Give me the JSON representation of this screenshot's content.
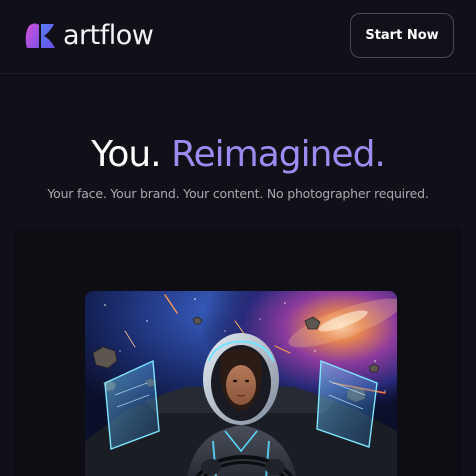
{
  "header": {
    "brand_name": "artflow",
    "logo_icon": "artflow-logo-icon",
    "cta_label": "Start Now"
  },
  "hero": {
    "title_part1": "You.",
    "title_part2": "Reimagined.",
    "subtitle": "Your face. Your brand. Your content. No photographer required."
  },
  "colors": {
    "background": "#111019",
    "accent": "#9c8cf2",
    "logo_purple": "#c74de0",
    "logo_blue": "#6a5cf0"
  },
  "showcase": {
    "image_icon": "astronaut-pilot-space-cockpit-image"
  }
}
